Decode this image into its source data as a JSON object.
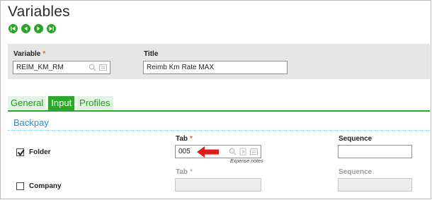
{
  "page": {
    "title": "Variables"
  },
  "nav": {
    "icons": [
      "first-icon",
      "previous-icon",
      "next-icon",
      "last-icon"
    ]
  },
  "header": {
    "variable": {
      "label": "Variable",
      "value": "REIM_KM_RM"
    },
    "title": {
      "label": "Title",
      "value": "Reimb Km Rate MAX"
    }
  },
  "tabs": [
    {
      "label": "General",
      "active": false
    },
    {
      "label": "Input",
      "active": true
    },
    {
      "label": "Profiles",
      "active": false
    }
  ],
  "section": {
    "title": "Backpay"
  },
  "columns": {
    "tab_label": "Tab",
    "sequence_label": "Sequence"
  },
  "rows": [
    {
      "label": "Folder",
      "checked": true,
      "tab_value": "005",
      "tab_hint": "Expense notes",
      "sequence_value": ""
    },
    {
      "label": "Company",
      "checked": false,
      "tab_value": "",
      "sequence_value": ""
    }
  ],
  "colors": {
    "accent": "#2ca62c",
    "section": "#2a8fcf",
    "required": "#e8542a",
    "arrow": "#e01b1b"
  }
}
